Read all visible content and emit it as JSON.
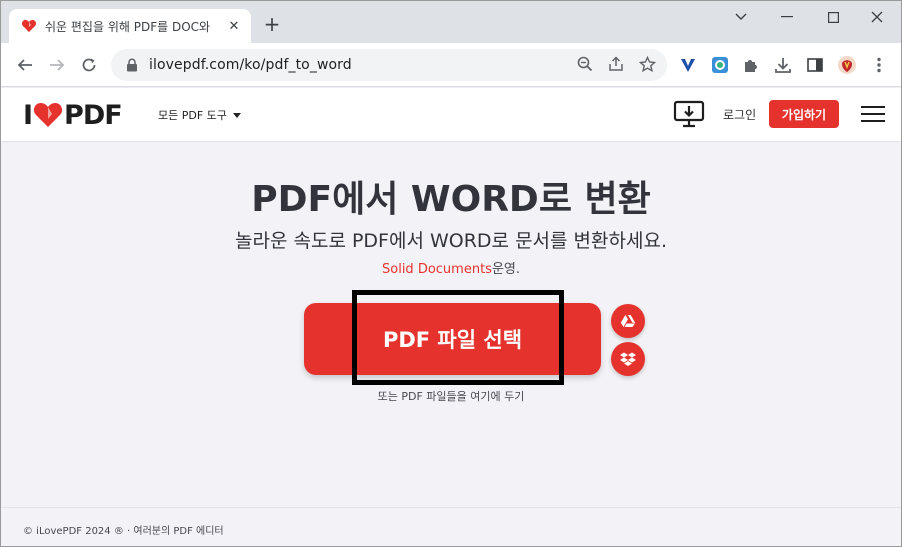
{
  "browser": {
    "tab_title": "쉬운 편집을 위해 PDF를 DOC와",
    "tab_close": "✕",
    "new_tab": "+",
    "url": "ilovepdf.com/ko/pdf_to_word",
    "window_controls": {
      "minimize": "—",
      "maximize": "☐",
      "close": "✕"
    }
  },
  "header": {
    "logo_left": "I",
    "logo_right": "PDF",
    "tools_menu": "모든 PDF 도구",
    "login": "로그인",
    "signup": "가입하기"
  },
  "main": {
    "title": "PDF에서 WORD로 변환",
    "subtitle": "놀라운 속도로 PDF에서 WORD로 문서를 변환하세요.",
    "credit_link": "Solid Documents",
    "credit_suffix": "운영.",
    "select_button": "PDF 파일 선택",
    "drop_hint": "또는 PDF 파일들을 여기에 두기"
  },
  "footer": {
    "copyright": "© iLovePDF 2024 ® · 여러분의 PDF 에디터"
  },
  "colors": {
    "brand_red": "#e5322d",
    "page_bg": "#f3f3f7",
    "text_dark": "#33333b"
  },
  "icons": {
    "favicon": "heart-icon",
    "lock": "lock-icon",
    "zoom": "zoom-icon",
    "share": "share-icon",
    "bookmark": "star-icon",
    "extensions": "puzzle-icon",
    "download": "download-icon",
    "sidepanel": "sidepanel-icon",
    "menu": "kebab-menu-icon",
    "google_drive": "google-drive-icon",
    "dropbox": "dropbox-icon",
    "desktop": "desktop-download-icon",
    "hamburger": "hamburger-menu-icon"
  }
}
